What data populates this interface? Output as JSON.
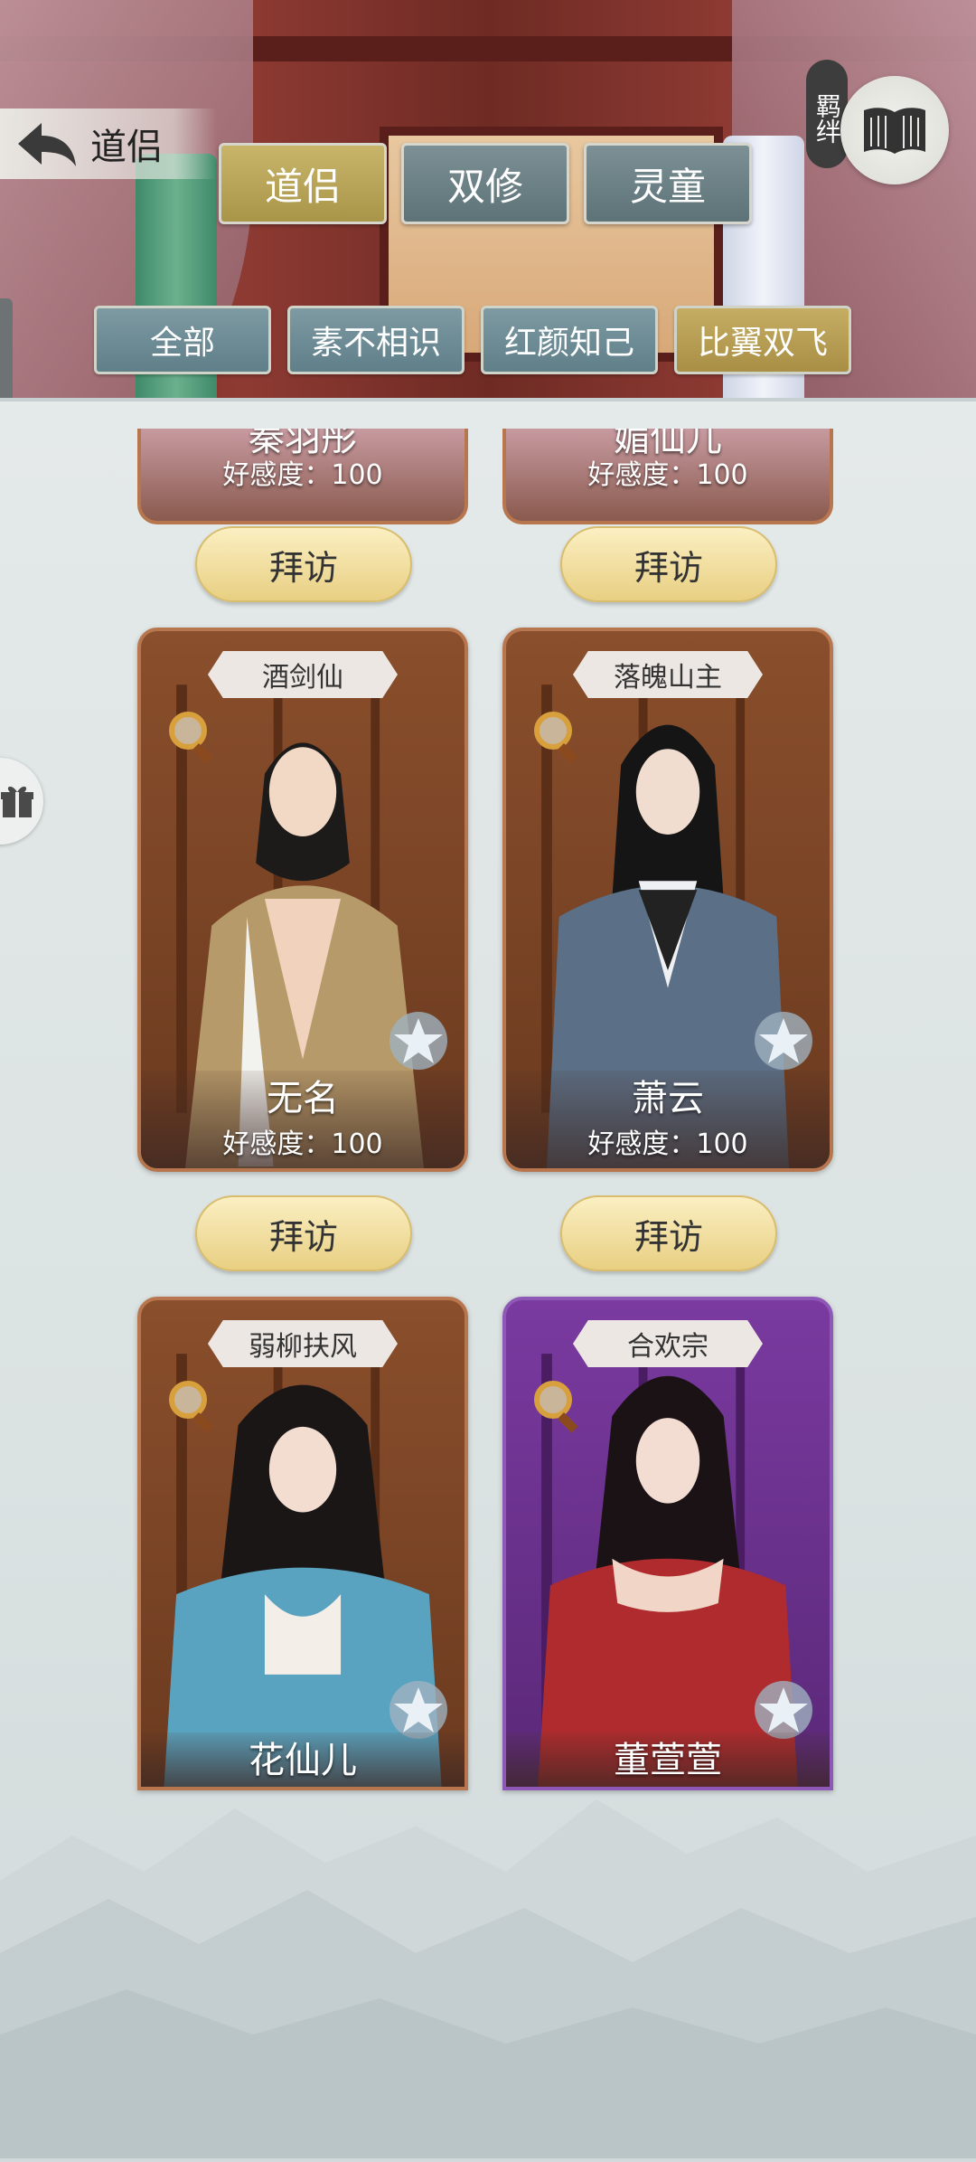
{
  "header": {
    "back_title": "道侣",
    "bond_label": "羁绊",
    "tabs": [
      {
        "label": "道侣",
        "active": true
      },
      {
        "label": "双修",
        "active": false
      },
      {
        "label": "灵童",
        "active": false
      }
    ],
    "filters": [
      {
        "label": "全部",
        "active": false
      },
      {
        "label": "素不相识",
        "active": false
      },
      {
        "label": "红颜知己",
        "active": false
      },
      {
        "label": "比翼双飞",
        "active": true
      }
    ]
  },
  "partial_cards": [
    {
      "name": "秦羽彤",
      "favor": "好感度：100"
    },
    {
      "name": "媚仙儿",
      "favor": "好感度：100"
    }
  ],
  "visit_label": "拜访",
  "cards": [
    {
      "title": "酒剑仙",
      "name": "无名",
      "favor": "好感度：100",
      "theme": "brown"
    },
    {
      "title": "落魄山主",
      "name": "萧云",
      "favor": "好感度：100",
      "theme": "brown"
    },
    {
      "title": "弱柳扶风",
      "name": "花仙儿",
      "favor": "",
      "theme": "brown"
    },
    {
      "title": "合欢宗",
      "name": "董萱萱",
      "favor": "",
      "theme": "purple"
    }
  ],
  "colors": {
    "tab_active": "#c9b56a",
    "tab_inactive": "#6c8186",
    "visit_button": "#f3e1a0",
    "card_brown": "#8a4f2c",
    "card_purple": "#7a3aa0"
  }
}
